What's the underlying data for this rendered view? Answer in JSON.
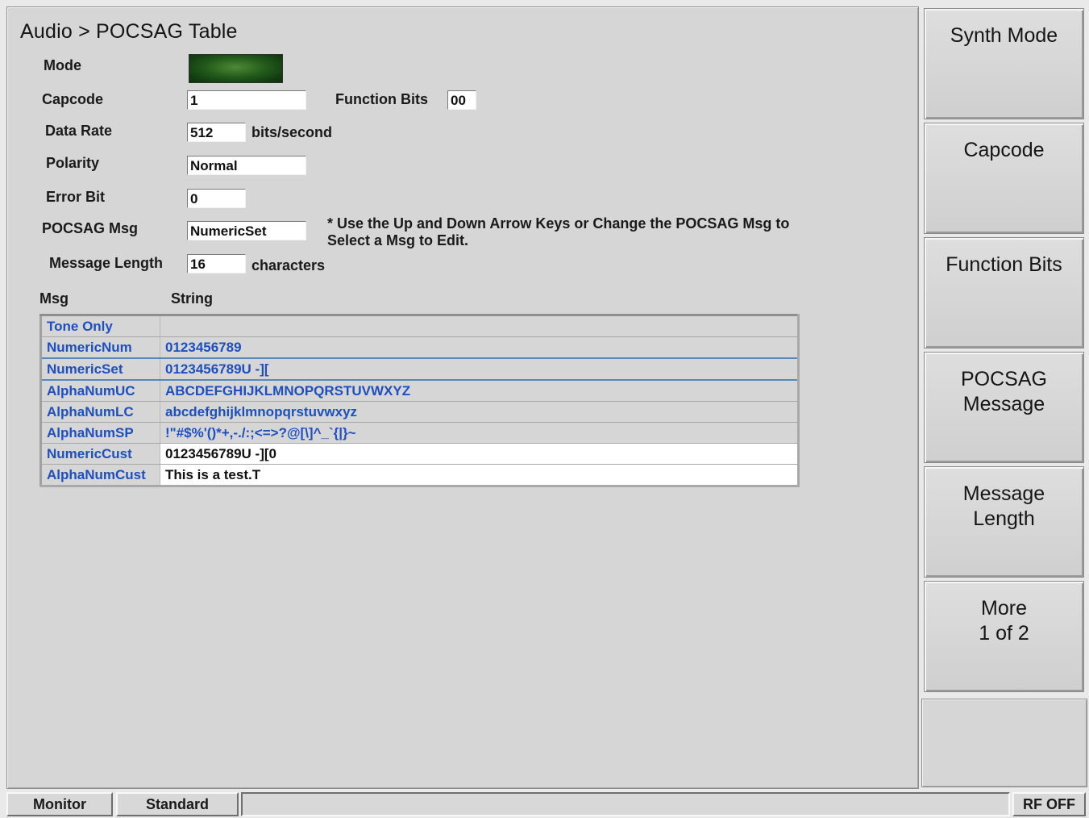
{
  "title": "Audio > POCSAG Table",
  "form": {
    "mode_label": "Mode",
    "capcode_label": "Capcode",
    "capcode_value": "1",
    "function_bits_label": "Function Bits",
    "function_bits_value": "00",
    "data_rate_label": "Data Rate",
    "data_rate_value": "512",
    "data_rate_unit": "bits/second",
    "polarity_label": "Polarity",
    "polarity_value": "Normal",
    "error_bit_label": "Error Bit",
    "error_bit_value": "0",
    "pocsag_msg_label": "POCSAG Msg",
    "pocsag_msg_value": "NumericSet",
    "message_length_label": "Message Length",
    "message_length_value": "16",
    "message_length_unit": "characters",
    "note": "* Use the Up and Down Arrow Keys or Change the POCSAG Msg to Select a Msg to Edit."
  },
  "table": {
    "headers": [
      "Msg",
      "String"
    ],
    "rows": [
      {
        "name": "Tone Only",
        "string": ""
      },
      {
        "name": "NumericNum",
        "string": "0123456789"
      },
      {
        "name": "NumericSet",
        "string": "0123456789U -]["
      },
      {
        "name": "AlphaNumUC",
        "string": "ABCDEFGHIJKLMNOPQRSTUVWXYZ"
      },
      {
        "name": "AlphaNumLC",
        "string": "abcdefghijklmnopqrstuvwxyz"
      },
      {
        "name": "AlphaNumSP",
        "string": " !\"#$%'()*+,-./:;<=>?@[\\]^_`{|}~"
      },
      {
        "name": "NumericCust",
        "string": "0123456789U -][0"
      },
      {
        "name": "AlphaNumCust",
        "string": "This is a test.T"
      }
    ]
  },
  "softkeys": [
    {
      "line1": "Synth Mode",
      "line2": ""
    },
    {
      "line1": "Capcode",
      "line2": ""
    },
    {
      "line1": "Function Bits",
      "line2": ""
    },
    {
      "line1": "POCSAG",
      "line2": "Message"
    },
    {
      "line1": "Message",
      "line2": "Length"
    },
    {
      "line1": "More",
      "line2": "1 of 2"
    }
  ],
  "status": {
    "monitor": "Monitor",
    "standard": "Standard",
    "rf": "RF OFF"
  },
  "colors": {
    "mode_indicator": "#245c1c",
    "table_text": "#1d4fbf",
    "selection_outline": "#5a86b8"
  }
}
